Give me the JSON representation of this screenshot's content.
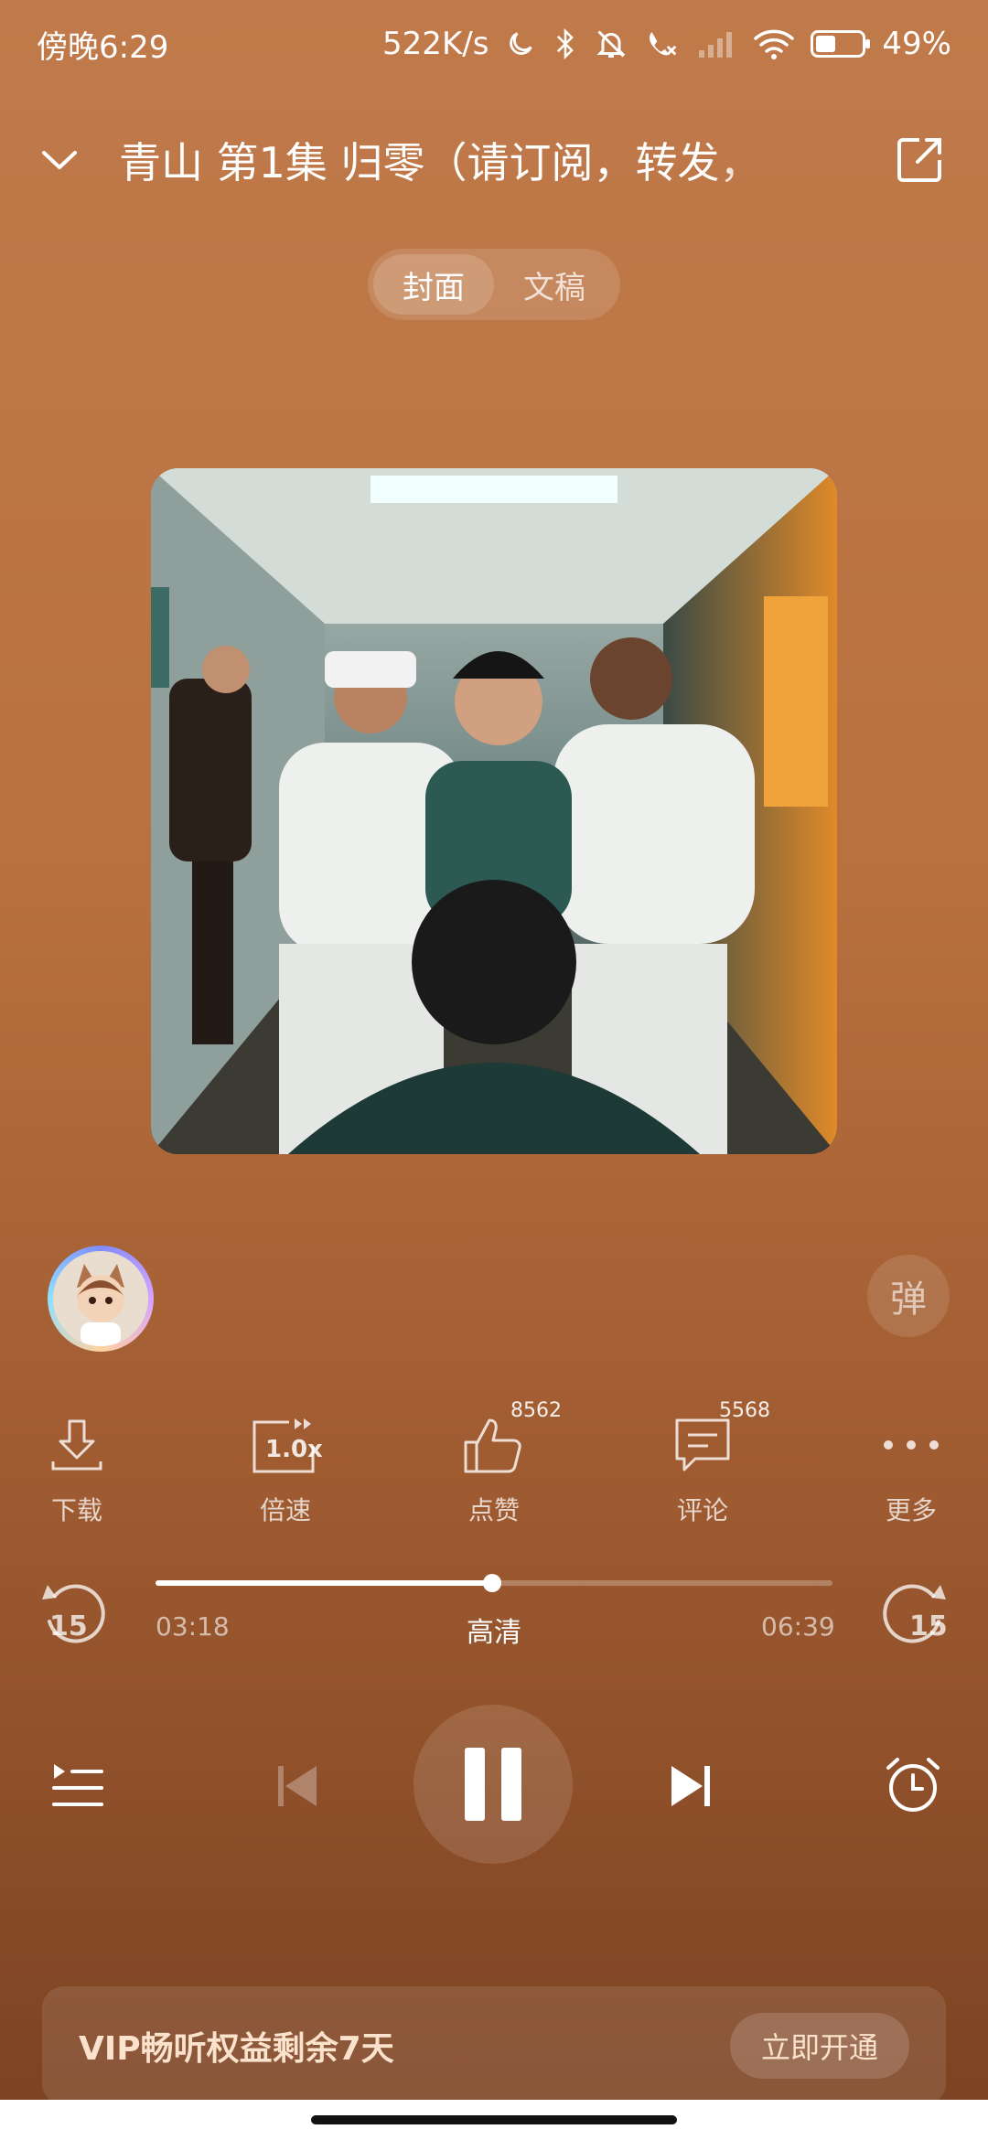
{
  "status_bar": {
    "time": "傍晚6:29",
    "network_speed": "522K/s",
    "battery_percent": "49%",
    "battery_level": 0.49,
    "icons": [
      "moon-icon",
      "bluetooth-icon",
      "mute-bell-icon",
      "call-forward-icon",
      "signal-icon",
      "wifi-icon",
      "battery-icon"
    ]
  },
  "header": {
    "title": "青山 第1集 归零（请订阅，转发，",
    "collapse_icon": "chevron-down-icon",
    "share_icon": "share-icon"
  },
  "tabs": [
    {
      "label": "封面",
      "active": true
    },
    {
      "label": "文稿",
      "active": false
    }
  ],
  "side": {
    "danmu_label": "弹"
  },
  "actions": [
    {
      "label": "下载",
      "icon": "download-icon",
      "badge": ""
    },
    {
      "label": "倍速",
      "icon": "speed-icon",
      "badge": "",
      "speed": "1.0x"
    },
    {
      "label": "点赞",
      "icon": "thumbs-up-icon",
      "badge": "8562"
    },
    {
      "label": "评论",
      "icon": "comment-icon",
      "badge": "5568"
    },
    {
      "label": "更多",
      "icon": "more-icon",
      "badge": ""
    }
  ],
  "progress": {
    "current": "03:18",
    "total": "06:39",
    "quality": "高清",
    "fraction": 0.497,
    "rewind_seconds": "15",
    "forward_seconds": "15"
  },
  "controls": {
    "playlist_icon": "playlist-icon",
    "prev_icon": "previous-icon",
    "play_state_icon": "pause-icon",
    "next_icon": "next-icon",
    "timer_icon": "alarm-clock-icon"
  },
  "vip": {
    "text": "VIP畅听权益剩余7天",
    "button": "立即开通"
  },
  "colors": {
    "background_top": "#c07a4b",
    "background_bottom": "#7a4222",
    "vip_text": "#fbe2cc"
  }
}
